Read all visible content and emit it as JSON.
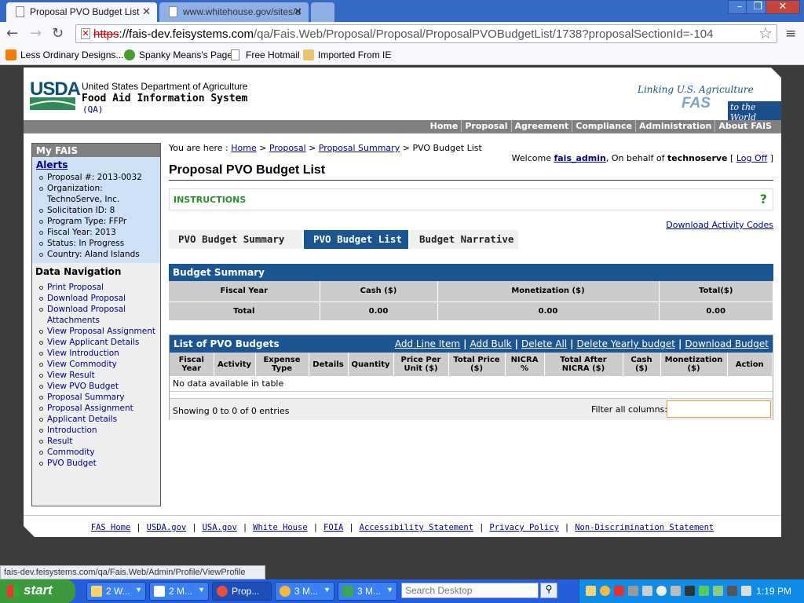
{
  "browser": {
    "tabs": [
      {
        "label": "Proposal PVO Budget List",
        "active": true
      },
      {
        "label": "www.whitehouse.gov/sites/d",
        "active": false
      }
    ],
    "url_scheme": "https",
    "url_host": "://fais-dev.feisystems.com",
    "url_path": "/qa/Fais.Web/Proposal/Proposal/ProposalPVOBudgetList/1738?proposalSectionId=-104",
    "bookmarks": [
      "Less Ordinary Designs...",
      "Spanky Means's Page",
      "Free Hotmail",
      "Imported From IE"
    ],
    "status_text": "fais-dev.feisystems.com/qa/Fais.Web/Admin/Profile/ViewProfile"
  },
  "header": {
    "logo": "USDA",
    "department": "United States Department of Agriculture",
    "system_name": "Food Aid Information System",
    "environment": "(QA)",
    "fas_tagline": "Linking U.S. Agriculture",
    "fas_name": "FAS",
    "fas_world": "to the World"
  },
  "topnav": [
    "Home",
    "Proposal",
    "Agreement",
    "Compliance",
    "Administration",
    "About FAIS"
  ],
  "sidebar": {
    "title": "My FAIS",
    "alerts_label": "Alerts",
    "alerts": [
      "Proposal #: 2013-0032",
      "Organization: TechnoServe, Inc.",
      "Solicitation ID: 8",
      "Program Type: FFPr",
      "Fiscal Year: 2013",
      "Status: In Progress",
      "Country: Aland Islands"
    ],
    "data_nav_label": "Data Navigation",
    "data_nav": [
      "Print Proposal",
      "Download Proposal",
      "Download Proposal Attachments",
      "View Proposal Assignment",
      "View Applicant Details",
      "View Introduction",
      "View Commodity",
      "View Result",
      "View PVO Budget",
      "Proposal Summary",
      "Proposal Assignment",
      "Applicant Details",
      "Introduction",
      "Result",
      "Commodity",
      "PVO Budget"
    ]
  },
  "breadcrumb": {
    "prefix": "You are here :",
    "items": [
      "Home",
      "Proposal",
      "Proposal Summary"
    ],
    "current": "PVO Budget List"
  },
  "welcome": {
    "prefix": "Welcome",
    "user": "fais_admin",
    "behalf": ", On behalf of",
    "org": "technoserve",
    "logoff": "Log Off"
  },
  "page_title": "Proposal PVO Budget List",
  "instructions": {
    "label": "INSTRUCTIONS",
    "help": "?"
  },
  "download_codes": "Download Activity Codes",
  "tabs": [
    {
      "label": "PVO Budget Summary",
      "active": false
    },
    {
      "label": "PVO Budget List",
      "active": true
    },
    {
      "label": "Budget Narrative",
      "active": false
    }
  ],
  "budget_summary": {
    "title": "Budget Summary",
    "columns": [
      "Fiscal Year",
      "Cash ($)",
      "Monetization ($)",
      "Total($)"
    ],
    "row": [
      "Total",
      "0.00",
      "0.00",
      "0.00"
    ]
  },
  "pvo_list": {
    "title": "List of PVO Budgets",
    "actions": [
      "Add Line Item",
      "Add Bulk",
      "Delete All",
      "Delete Yearly budget",
      "Download Budget"
    ],
    "columns": [
      [
        "Fiscal",
        "Year"
      ],
      [
        "Activity"
      ],
      [
        "Expense",
        "Type"
      ],
      [
        "Details"
      ],
      [
        "Quantity"
      ],
      [
        "Price Per",
        "Unit ($)"
      ],
      [
        "Total Price",
        "($)"
      ],
      [
        "NICRA",
        "%"
      ],
      [
        "Total After",
        "NICRA ($)"
      ],
      [
        "Cash",
        "($)"
      ],
      [
        "Monetization",
        "($)"
      ],
      [
        "Action"
      ]
    ],
    "empty": "No data available in table",
    "info": "Showing 0 to 0 of 0 entries",
    "filter_label": "Filter all columns:",
    "filter_value": ""
  },
  "footer": [
    "FAS Home",
    "USDA.gov",
    "USA.gov",
    "White House",
    "FOIA",
    "Accessibility Statement",
    "Privacy Policy",
    "Non-Discrimination Statement"
  ],
  "taskbar": {
    "start": "start",
    "buttons": [
      "2 W...",
      "2 M...",
      "Prop...",
      "3 M...",
      "3 M..."
    ],
    "search_placeholder": "Search Desktop",
    "clock": "1:19 PM"
  },
  "colors": {
    "accent": "#1b5693",
    "nav_gray": "#808080",
    "instructions": "#2e8b2e",
    "link": "#00008b"
  }
}
